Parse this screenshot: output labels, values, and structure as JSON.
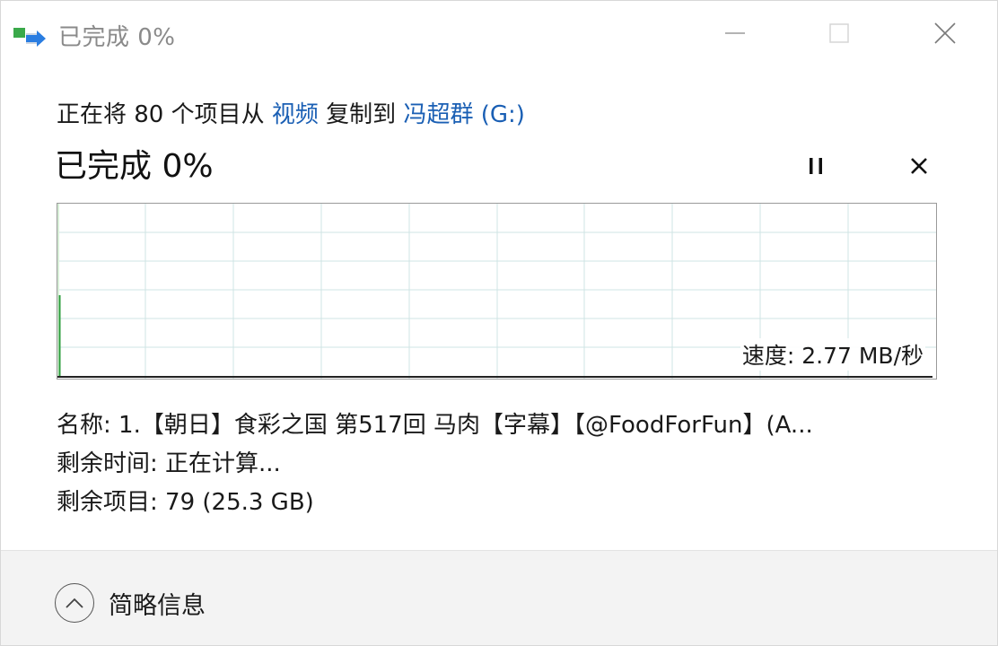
{
  "window": {
    "title": "已完成 0%"
  },
  "copy": {
    "prefix": "正在将 80 个项目从 ",
    "source": "视频",
    "middle": " 复制到 ",
    "destination": "冯超群 (G:)"
  },
  "progress": {
    "heading": "已完成 0%",
    "fraction": 0.0
  },
  "graph": {
    "speed_label": "速度: 2.77 MB/秒"
  },
  "details": {
    "name_label": "名称: ",
    "name_value": "1.【朝日】食彩之国 第517回 马肉【字幕】【@FoodForFun】(A...",
    "time_label": "剩余时间: ",
    "time_value": "正在计算...",
    "items_label": "剩余项目: ",
    "items_value": "79 (25.3 GB)"
  },
  "footer": {
    "toggle_label": "简略信息"
  },
  "colors": {
    "link": "#1a5fb4",
    "graph_grid": "#cfe4e4",
    "graph_progress": "#2e9e3e",
    "graph_baseline": "#222222"
  },
  "icons": {
    "app": "copy-transfer-icon",
    "minimize": "minimize-icon",
    "maximize": "maximize-icon",
    "close": "close-icon",
    "pause": "pause-icon",
    "cancel": "cancel-icon",
    "toggle": "chevron-up-icon"
  }
}
